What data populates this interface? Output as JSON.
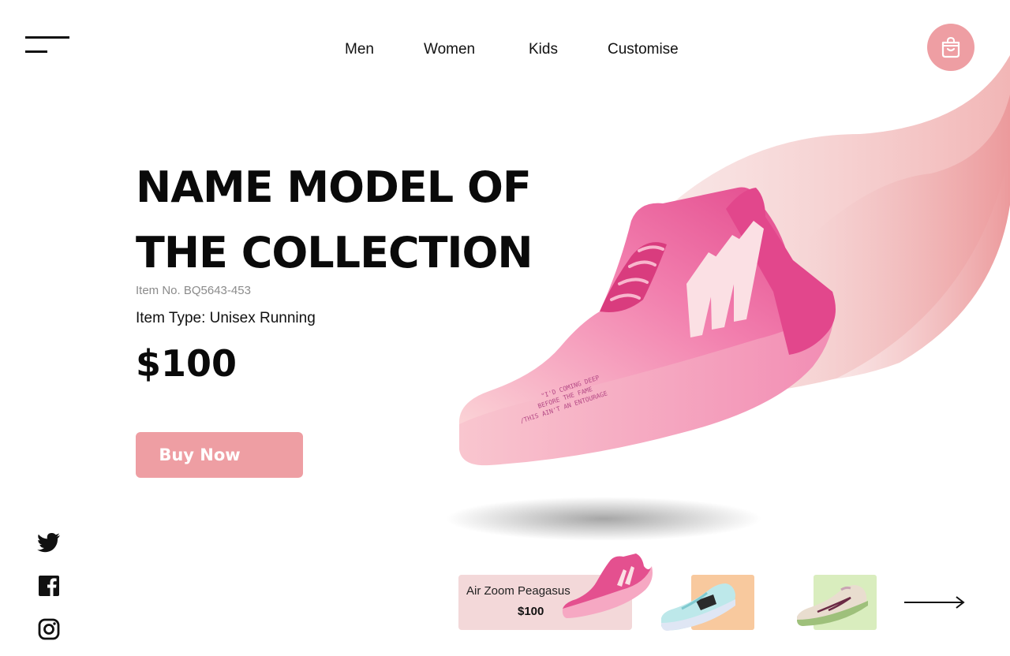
{
  "nav": {
    "items": [
      "Men",
      "Women",
      "Kids",
      "Customise"
    ]
  },
  "hero": {
    "title_line1": "NAME MODEL OF",
    "title_line2": "THE COLLECTION",
    "item_no": "Item No. BQ5643-453",
    "item_type": "Item Type: Unisex Running",
    "price": "$100",
    "buy_label": "Buy Now",
    "shoe_print_1": "\"I'D COMING DEEP",
    "shoe_print_2": "BEFORE THE FAME",
    "shoe_print_3": "/THIS AIN'T AN ENTOURAGE"
  },
  "carousel": {
    "items": [
      {
        "name": "Air Zoom Peagasus",
        "price": "$100",
        "bg": "#f3d8d9"
      },
      {
        "bg": "#f8c99e"
      },
      {
        "bg": "#d9edbe"
      }
    ]
  },
  "social": [
    "twitter-icon",
    "facebook-icon",
    "instagram-icon"
  ],
  "colors": {
    "accent": "#ee9ea3",
    "shoe_pink": "#e8559a",
    "text": "#111111",
    "muted": "#8b8b8b"
  }
}
